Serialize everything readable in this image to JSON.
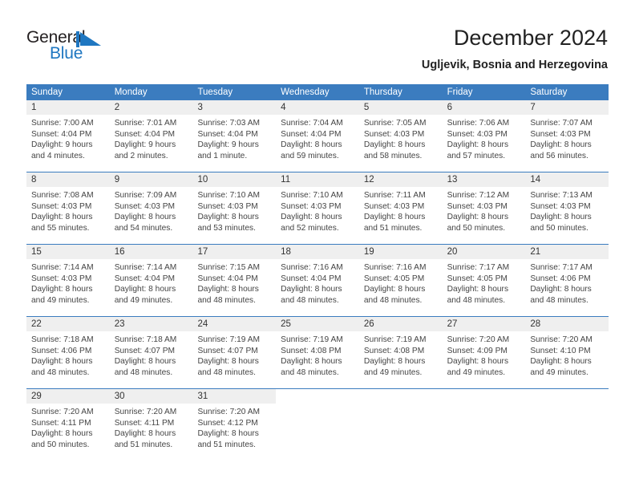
{
  "brand": {
    "name_top": "General",
    "name_bottom": "Blue",
    "flag_icon": "blue-triangle-flag-icon",
    "color_primary": "#1f77c1",
    "color_text": "#231f20"
  },
  "header": {
    "title": "December 2024",
    "subtitle": "Ugljevik, Bosnia and Herzegovina"
  },
  "theme": {
    "header_blue": "#3b7cbf",
    "daynum_band": "#efefef",
    "text": "#222222"
  },
  "calendar": {
    "weekday_headers": [
      "Sunday",
      "Monday",
      "Tuesday",
      "Wednesday",
      "Thursday",
      "Friday",
      "Saturday"
    ],
    "weeks": [
      [
        {
          "day": "1",
          "sunrise": "Sunrise: 7:00 AM",
          "sunset": "Sunset: 4:04 PM",
          "daylight_line1": "Daylight: 9 hours",
          "daylight_line2": "and 4 minutes."
        },
        {
          "day": "2",
          "sunrise": "Sunrise: 7:01 AM",
          "sunset": "Sunset: 4:04 PM",
          "daylight_line1": "Daylight: 9 hours",
          "daylight_line2": "and 2 minutes."
        },
        {
          "day": "3",
          "sunrise": "Sunrise: 7:03 AM",
          "sunset": "Sunset: 4:04 PM",
          "daylight_line1": "Daylight: 9 hours",
          "daylight_line2": "and 1 minute."
        },
        {
          "day": "4",
          "sunrise": "Sunrise: 7:04 AM",
          "sunset": "Sunset: 4:04 PM",
          "daylight_line1": "Daylight: 8 hours",
          "daylight_line2": "and 59 minutes."
        },
        {
          "day": "5",
          "sunrise": "Sunrise: 7:05 AM",
          "sunset": "Sunset: 4:03 PM",
          "daylight_line1": "Daylight: 8 hours",
          "daylight_line2": "and 58 minutes."
        },
        {
          "day": "6",
          "sunrise": "Sunrise: 7:06 AM",
          "sunset": "Sunset: 4:03 PM",
          "daylight_line1": "Daylight: 8 hours",
          "daylight_line2": "and 57 minutes."
        },
        {
          "day": "7",
          "sunrise": "Sunrise: 7:07 AM",
          "sunset": "Sunset: 4:03 PM",
          "daylight_line1": "Daylight: 8 hours",
          "daylight_line2": "and 56 minutes."
        }
      ],
      [
        {
          "day": "8",
          "sunrise": "Sunrise: 7:08 AM",
          "sunset": "Sunset: 4:03 PM",
          "daylight_line1": "Daylight: 8 hours",
          "daylight_line2": "and 55 minutes."
        },
        {
          "day": "9",
          "sunrise": "Sunrise: 7:09 AM",
          "sunset": "Sunset: 4:03 PM",
          "daylight_line1": "Daylight: 8 hours",
          "daylight_line2": "and 54 minutes."
        },
        {
          "day": "10",
          "sunrise": "Sunrise: 7:10 AM",
          "sunset": "Sunset: 4:03 PM",
          "daylight_line1": "Daylight: 8 hours",
          "daylight_line2": "and 53 minutes."
        },
        {
          "day": "11",
          "sunrise": "Sunrise: 7:10 AM",
          "sunset": "Sunset: 4:03 PM",
          "daylight_line1": "Daylight: 8 hours",
          "daylight_line2": "and 52 minutes."
        },
        {
          "day": "12",
          "sunrise": "Sunrise: 7:11 AM",
          "sunset": "Sunset: 4:03 PM",
          "daylight_line1": "Daylight: 8 hours",
          "daylight_line2": "and 51 minutes."
        },
        {
          "day": "13",
          "sunrise": "Sunrise: 7:12 AM",
          "sunset": "Sunset: 4:03 PM",
          "daylight_line1": "Daylight: 8 hours",
          "daylight_line2": "and 50 minutes."
        },
        {
          "day": "14",
          "sunrise": "Sunrise: 7:13 AM",
          "sunset": "Sunset: 4:03 PM",
          "daylight_line1": "Daylight: 8 hours",
          "daylight_line2": "and 50 minutes."
        }
      ],
      [
        {
          "day": "15",
          "sunrise": "Sunrise: 7:14 AM",
          "sunset": "Sunset: 4:03 PM",
          "daylight_line1": "Daylight: 8 hours",
          "daylight_line2": "and 49 minutes."
        },
        {
          "day": "16",
          "sunrise": "Sunrise: 7:14 AM",
          "sunset": "Sunset: 4:04 PM",
          "daylight_line1": "Daylight: 8 hours",
          "daylight_line2": "and 49 minutes."
        },
        {
          "day": "17",
          "sunrise": "Sunrise: 7:15 AM",
          "sunset": "Sunset: 4:04 PM",
          "daylight_line1": "Daylight: 8 hours",
          "daylight_line2": "and 48 minutes."
        },
        {
          "day": "18",
          "sunrise": "Sunrise: 7:16 AM",
          "sunset": "Sunset: 4:04 PM",
          "daylight_line1": "Daylight: 8 hours",
          "daylight_line2": "and 48 minutes."
        },
        {
          "day": "19",
          "sunrise": "Sunrise: 7:16 AM",
          "sunset": "Sunset: 4:05 PM",
          "daylight_line1": "Daylight: 8 hours",
          "daylight_line2": "and 48 minutes."
        },
        {
          "day": "20",
          "sunrise": "Sunrise: 7:17 AM",
          "sunset": "Sunset: 4:05 PM",
          "daylight_line1": "Daylight: 8 hours",
          "daylight_line2": "and 48 minutes."
        },
        {
          "day": "21",
          "sunrise": "Sunrise: 7:17 AM",
          "sunset": "Sunset: 4:06 PM",
          "daylight_line1": "Daylight: 8 hours",
          "daylight_line2": "and 48 minutes."
        }
      ],
      [
        {
          "day": "22",
          "sunrise": "Sunrise: 7:18 AM",
          "sunset": "Sunset: 4:06 PM",
          "daylight_line1": "Daylight: 8 hours",
          "daylight_line2": "and 48 minutes."
        },
        {
          "day": "23",
          "sunrise": "Sunrise: 7:18 AM",
          "sunset": "Sunset: 4:07 PM",
          "daylight_line1": "Daylight: 8 hours",
          "daylight_line2": "and 48 minutes."
        },
        {
          "day": "24",
          "sunrise": "Sunrise: 7:19 AM",
          "sunset": "Sunset: 4:07 PM",
          "daylight_line1": "Daylight: 8 hours",
          "daylight_line2": "and 48 minutes."
        },
        {
          "day": "25",
          "sunrise": "Sunrise: 7:19 AM",
          "sunset": "Sunset: 4:08 PM",
          "daylight_line1": "Daylight: 8 hours",
          "daylight_line2": "and 48 minutes."
        },
        {
          "day": "26",
          "sunrise": "Sunrise: 7:19 AM",
          "sunset": "Sunset: 4:08 PM",
          "daylight_line1": "Daylight: 8 hours",
          "daylight_line2": "and 49 minutes."
        },
        {
          "day": "27",
          "sunrise": "Sunrise: 7:20 AM",
          "sunset": "Sunset: 4:09 PM",
          "daylight_line1": "Daylight: 8 hours",
          "daylight_line2": "and 49 minutes."
        },
        {
          "day": "28",
          "sunrise": "Sunrise: 7:20 AM",
          "sunset": "Sunset: 4:10 PM",
          "daylight_line1": "Daylight: 8 hours",
          "daylight_line2": "and 49 minutes."
        }
      ],
      [
        {
          "day": "29",
          "sunrise": "Sunrise: 7:20 AM",
          "sunset": "Sunset: 4:11 PM",
          "daylight_line1": "Daylight: 8 hours",
          "daylight_line2": "and 50 minutes."
        },
        {
          "day": "30",
          "sunrise": "Sunrise: 7:20 AM",
          "sunset": "Sunset: 4:11 PM",
          "daylight_line1": "Daylight: 8 hours",
          "daylight_line2": "and 51 minutes."
        },
        {
          "day": "31",
          "sunrise": "Sunrise: 7:20 AM",
          "sunset": "Sunset: 4:12 PM",
          "daylight_line1": "Daylight: 8 hours",
          "daylight_line2": "and 51 minutes."
        },
        {
          "day": "",
          "sunrise": "",
          "sunset": "",
          "daylight_line1": "",
          "daylight_line2": ""
        },
        {
          "day": "",
          "sunrise": "",
          "sunset": "",
          "daylight_line1": "",
          "daylight_line2": ""
        },
        {
          "day": "",
          "sunrise": "",
          "sunset": "",
          "daylight_line1": "",
          "daylight_line2": ""
        },
        {
          "day": "",
          "sunrise": "",
          "sunset": "",
          "daylight_line1": "",
          "daylight_line2": ""
        }
      ]
    ]
  }
}
